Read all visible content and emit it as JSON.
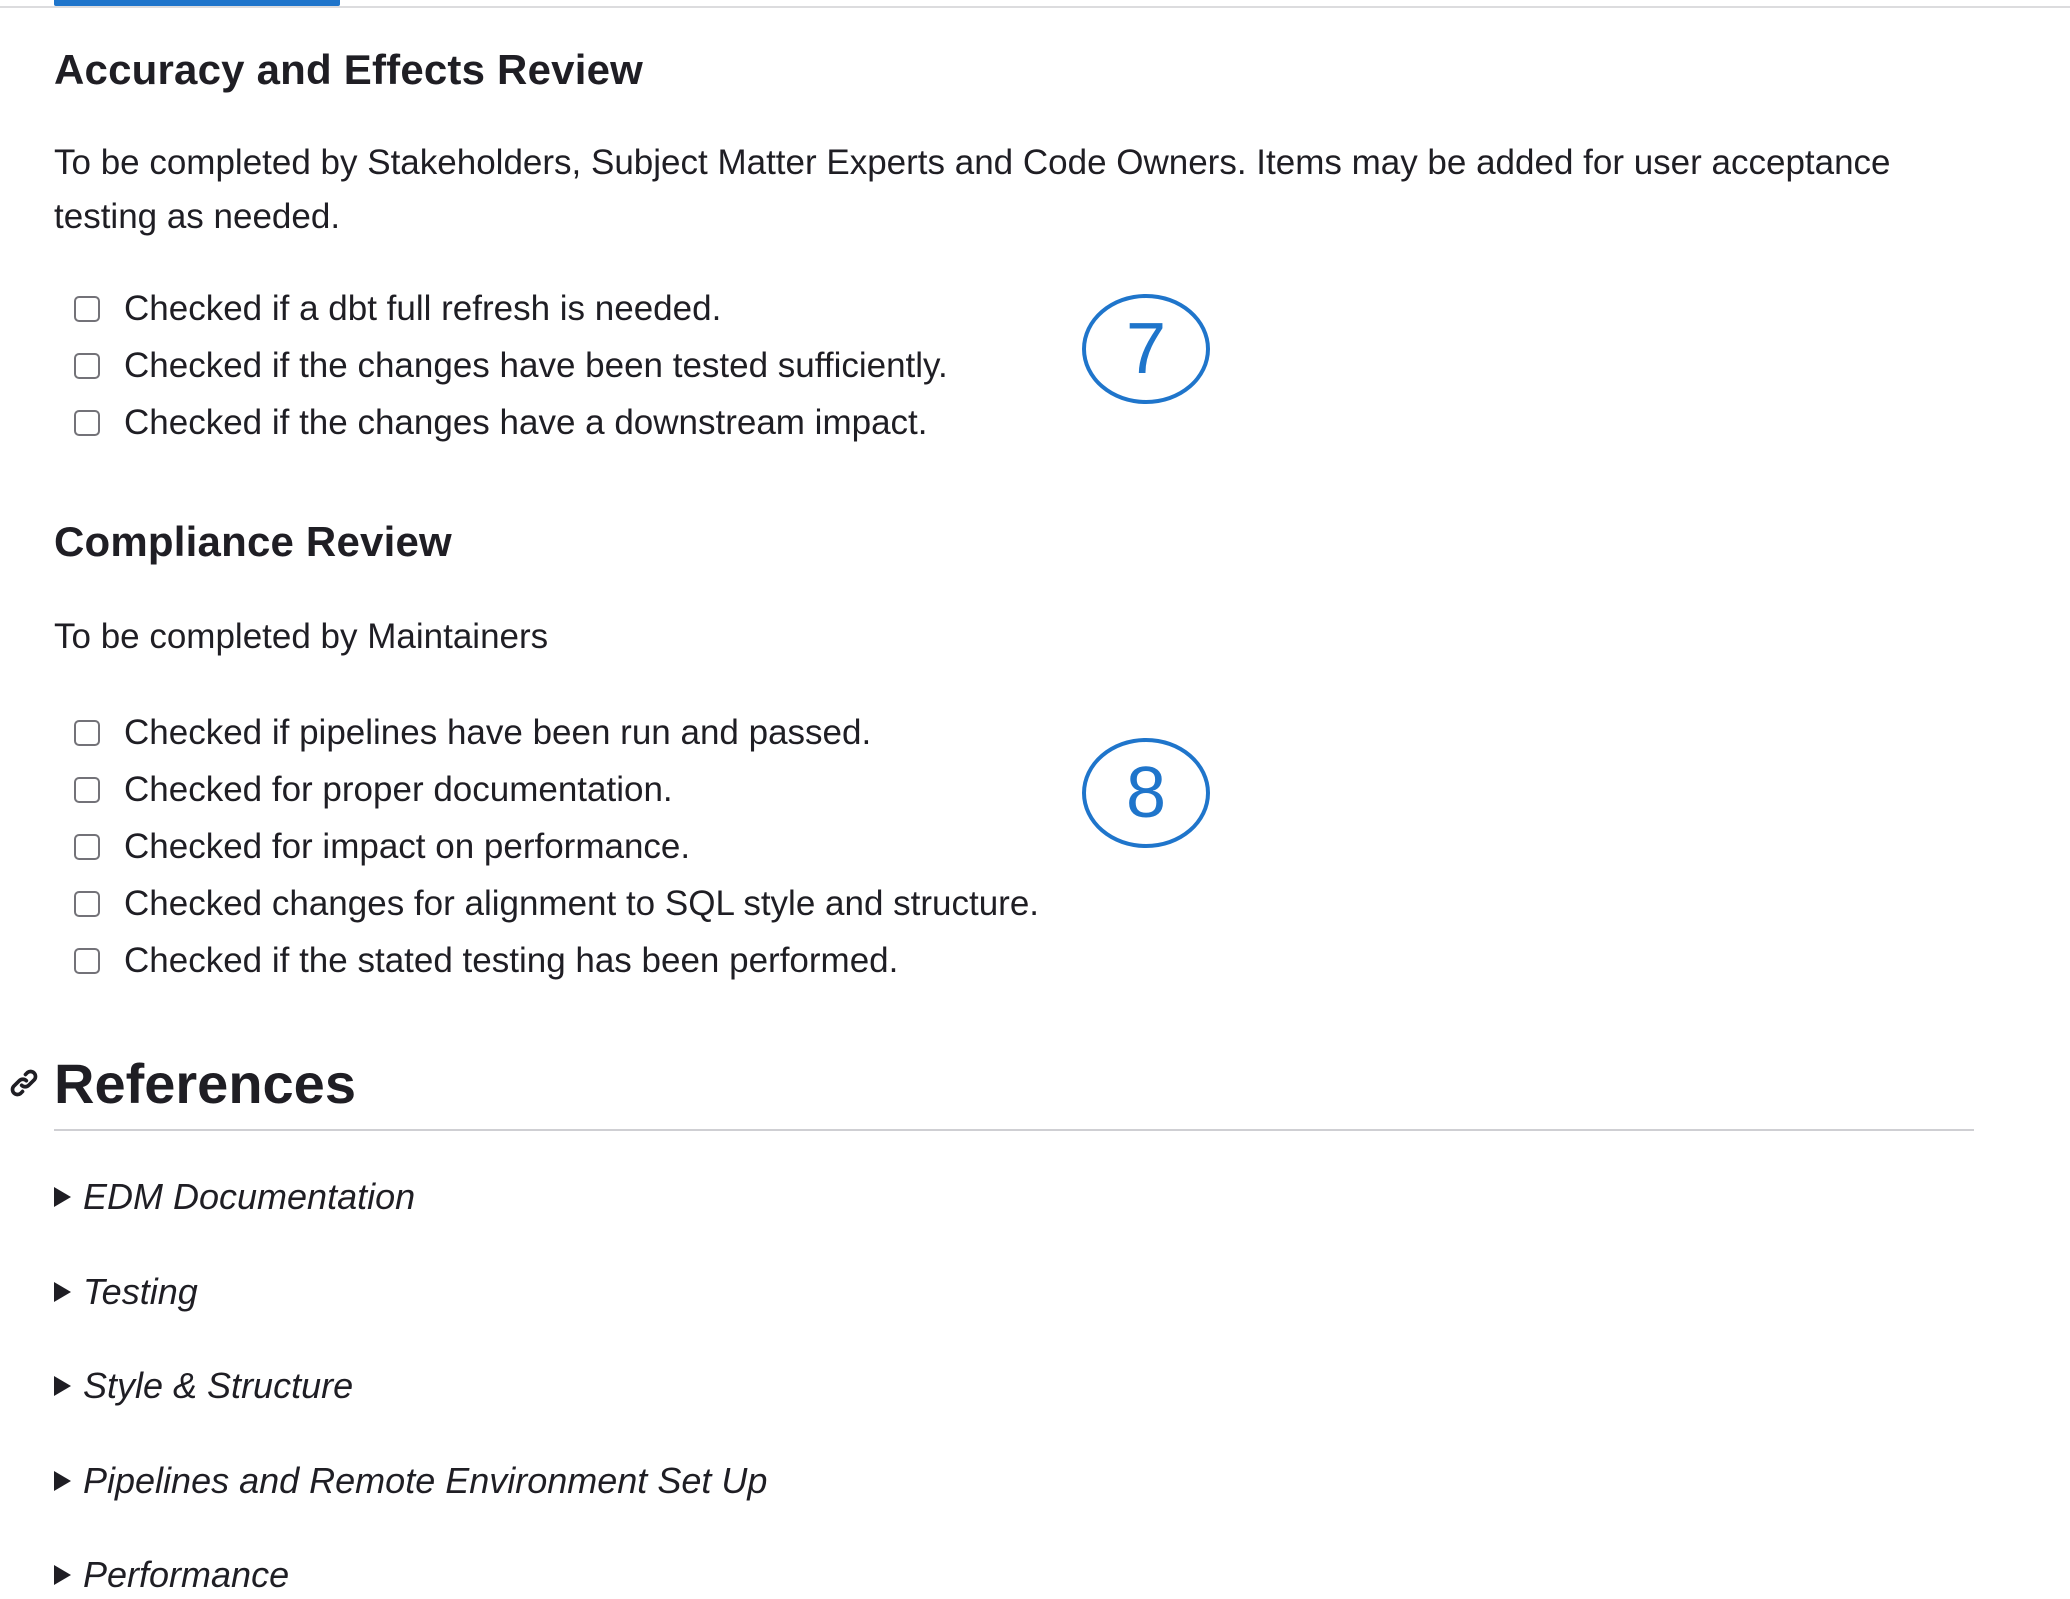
{
  "accuracy_review": {
    "title": "Accuracy and Effects Review",
    "description": "To be completed by Stakeholders, Subject Matter Experts and Code Owners. Items may be added for user acceptance testing as needed.",
    "items": [
      {
        "label": "Checked if a dbt full refresh is needed.",
        "checked": false
      },
      {
        "label": "Checked if the changes have been tested sufficiently.",
        "checked": false
      },
      {
        "label": "Checked if the changes have a downstream impact.",
        "checked": false
      }
    ],
    "callout": "7"
  },
  "compliance_review": {
    "title": "Compliance Review",
    "description": "To be completed by Maintainers",
    "items": [
      {
        "label": "Checked if pipelines have been run and passed.",
        "checked": false
      },
      {
        "label": "Checked for proper documentation.",
        "checked": false
      },
      {
        "label": "Checked for impact on performance.",
        "checked": false
      },
      {
        "label": "Checked changes for alignment to SQL style and structure.",
        "checked": false
      },
      {
        "label": "Checked if the stated testing has been performed.",
        "checked": false
      }
    ],
    "callout": "8"
  },
  "references": {
    "title": "References",
    "icon": "link-icon",
    "sections": [
      {
        "label": "EDM Documentation",
        "expanded": false
      },
      {
        "label": "Testing",
        "expanded": false
      },
      {
        "label": "Style & Structure",
        "expanded": false
      },
      {
        "label": "Pipelines and Remote Environment Set Up",
        "expanded": false
      },
      {
        "label": "Performance",
        "expanded": false
      }
    ]
  },
  "colors": {
    "accent": "#1f75cb",
    "text": "#1f1e24",
    "checkbox_border": "#737278"
  }
}
